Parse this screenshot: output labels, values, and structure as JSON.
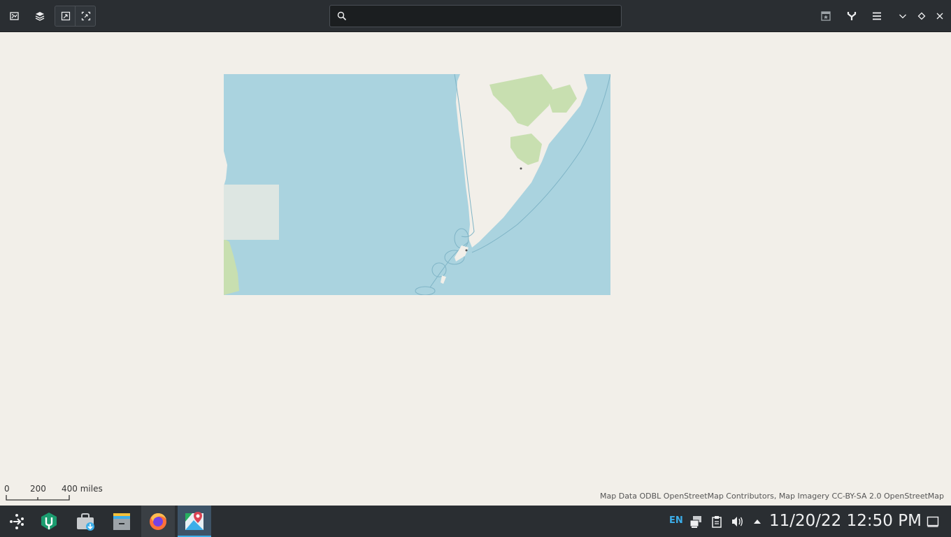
{
  "header": {
    "left_buttons": [
      {
        "name": "show-panels-icon"
      },
      {
        "name": "layers-icon"
      },
      {
        "name": "zoom-out-fit-icon"
      },
      {
        "name": "zoom-in-fit-icon"
      }
    ],
    "search": {
      "value": "",
      "placeholder": ""
    },
    "right_buttons": [
      {
        "name": "bookmark-icon"
      },
      {
        "name": "routing-icon"
      },
      {
        "name": "hamburger-menu-icon"
      }
    ],
    "window_controls": [
      {
        "name": "minimize-icon"
      },
      {
        "name": "maximize-icon"
      },
      {
        "name": "close-icon"
      }
    ]
  },
  "map": {
    "scale": {
      "labels": [
        "0",
        "200",
        "400 miles"
      ]
    },
    "attribution": "Map Data ODBL OpenStreetMap Contributors, Map Imagery CC-BY-SA 2.0 OpenStreetMap",
    "colors": {
      "water": "#aad3df",
      "land": "#f2efe9",
      "forest": "#c8dfb0"
    }
  },
  "taskbar": {
    "apps": [
      {
        "name": "application-launcher-icon"
      },
      {
        "name": "discover-icon"
      },
      {
        "name": "store-icon"
      },
      {
        "name": "file-manager-icon"
      },
      {
        "name": "firefox-icon"
      },
      {
        "name": "maps-app-icon"
      }
    ],
    "tray": {
      "language": "EN",
      "clock": "11/20/22 12:50 PM"
    }
  }
}
